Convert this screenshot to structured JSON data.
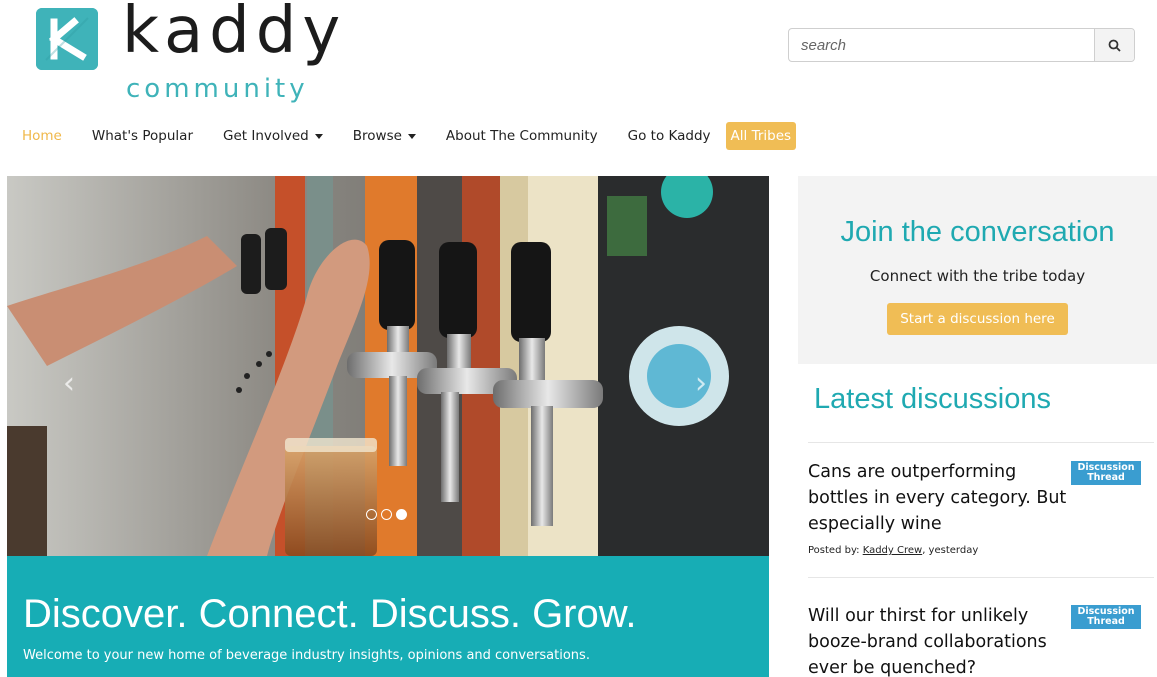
{
  "brand": {
    "name": "kaddy",
    "sub": "community",
    "accent": "#3fb3b9",
    "highlight": "#f0bd55"
  },
  "search": {
    "placeholder": "search",
    "icon": "search-icon"
  },
  "nav": {
    "items": [
      {
        "label": "Home",
        "active": true
      },
      {
        "label": "What's Popular"
      },
      {
        "label": "Get Involved",
        "dropdown": true
      },
      {
        "label": "Browse",
        "dropdown": true
      },
      {
        "label": "About The Community"
      },
      {
        "label": "Go to Kaddy"
      }
    ],
    "pill": "All Tribes"
  },
  "hero": {
    "title": "Discover. Connect. Discuss. Grow.",
    "subtitle": "Welcome to your new home of beverage industry insights, opinions and conversations.",
    "prev_icon": "chevron-left-icon",
    "next_icon": "chevron-right-icon",
    "slide_count": 3,
    "active_slide": 3
  },
  "cta": {
    "title": "Join the conversation",
    "subtitle": "Connect with the tribe today",
    "button": "Start a discussion here"
  },
  "latest": {
    "title": "Latest discussions",
    "items": [
      {
        "title": "Cans are outperforming bottles in every category. But especially wine",
        "badge": "Discussion Thread",
        "posted_prefix": "Posted by: ",
        "author": "Kaddy Crew",
        "when": ", yesterday"
      },
      {
        "title": "Will our thirst for unlikely booze-brand collaborations ever be quenched?",
        "badge": "Discussion Thread"
      }
    ]
  }
}
